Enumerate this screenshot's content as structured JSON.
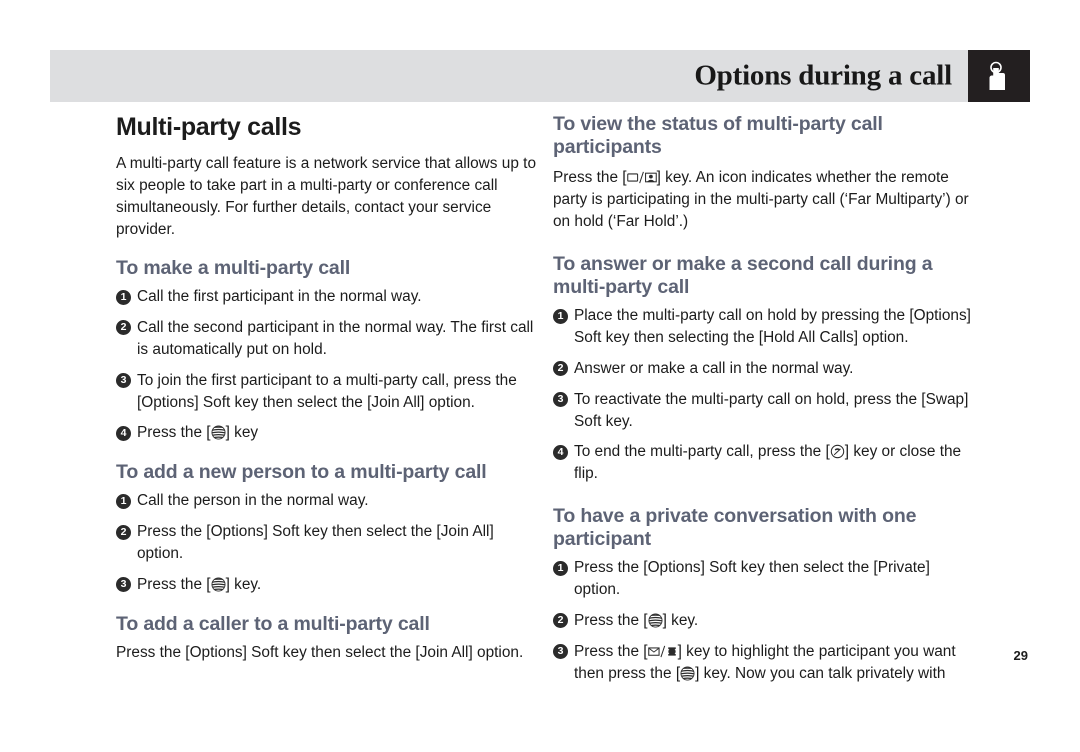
{
  "header": {
    "title": "Options during a call",
    "icon": "hand-press-icon"
  },
  "page_number": "29",
  "colors": {
    "header_bar": "#dddee0",
    "header_icon_box": "#231f20",
    "subheading": "#5d6375",
    "body_text": "#1c1c1c",
    "marker": "#2b2b2b"
  },
  "left_column": {
    "section_title": "Multi-party calls",
    "intro": "A multi-party call feature is a network service that allows up to six people to take part in a multi-party or conference call simultaneously. For further details, contact your service provider.",
    "blocks": [
      {
        "heading": "To make a multi-party call",
        "steps": [
          {
            "num": "1",
            "pre": "Call the first participant in the normal way.",
            "icon": "",
            "post": ""
          },
          {
            "num": "2",
            "pre": "Call the second participant in the normal way. The first call is automatically put on hold.",
            "icon": "",
            "post": ""
          },
          {
            "num": "3",
            "pre": "To join the first participant to a multi-party call, press the [Options] Soft key then select the [Join All] option.",
            "icon": "",
            "post": ""
          },
          {
            "num": "4",
            "pre": "Press the [",
            "icon": "att-globe-icon",
            "post": "] key"
          }
        ]
      },
      {
        "heading": "To add a new person to a multi-party call",
        "steps": [
          {
            "num": "1",
            "pre": "Call the person in the normal way.",
            "icon": "",
            "post": ""
          },
          {
            "num": "2",
            "pre": "Press the [Options] Soft key then select the [Join All] option.",
            "icon": "",
            "post": ""
          },
          {
            "num": "3",
            "pre": "Press the [",
            "icon": "att-globe-icon",
            "post": "] key."
          }
        ]
      },
      {
        "heading": "To add a caller to a multi-party call",
        "paragraph": "Press the [Options] Soft key then select the [Join All] option."
      }
    ]
  },
  "right_column": {
    "blocks": [
      {
        "heading": "To view the status of multi-party call participants",
        "paragraph_pre": "Press the [",
        "paragraph_icon": "envelope-slash-contact-icon",
        "paragraph_post": "] key. An icon indicates whether the remote party is participating in the multi-party call (‘Far Multiparty’) or on hold (‘Far Hold’.)"
      },
      {
        "heading": "To answer or make a second call during a multi-party call",
        "steps": [
          {
            "num": "1",
            "pre": "Place the multi-party call on hold by pressing the [Options] Soft key then selecting the [Hold All Calls] option.",
            "icon": "",
            "post": ""
          },
          {
            "num": "2",
            "pre": "Answer or make a call in the normal way.",
            "icon": "",
            "post": ""
          },
          {
            "num": "3",
            "pre": "To reactivate the multi-party call on hold, press the [Swap] Soft key.",
            "icon": "",
            "post": ""
          },
          {
            "num": "4",
            "pre": "To end the multi-party call, press the [",
            "icon": "end-call-icon",
            "post": "] key or close the flip."
          }
        ]
      },
      {
        "heading": "To have a private conversation with one participant",
        "steps": [
          {
            "num": "1",
            "pre": "Press the [Options] Soft key then select the [Private] option.",
            "icon": "",
            "post": ""
          },
          {
            "num": "2",
            "pre": "Press the [",
            "icon": "att-globe-icon",
            "post": "] key."
          },
          {
            "num": "3",
            "pre": "Press the [",
            "icon": "envelope-slash-phone-icon",
            "post": "] key to highlight the participant you want then press the [",
            "icon2": "att-globe-icon",
            "post2": "] key. Now you can talk privately with"
          }
        ]
      }
    ]
  }
}
